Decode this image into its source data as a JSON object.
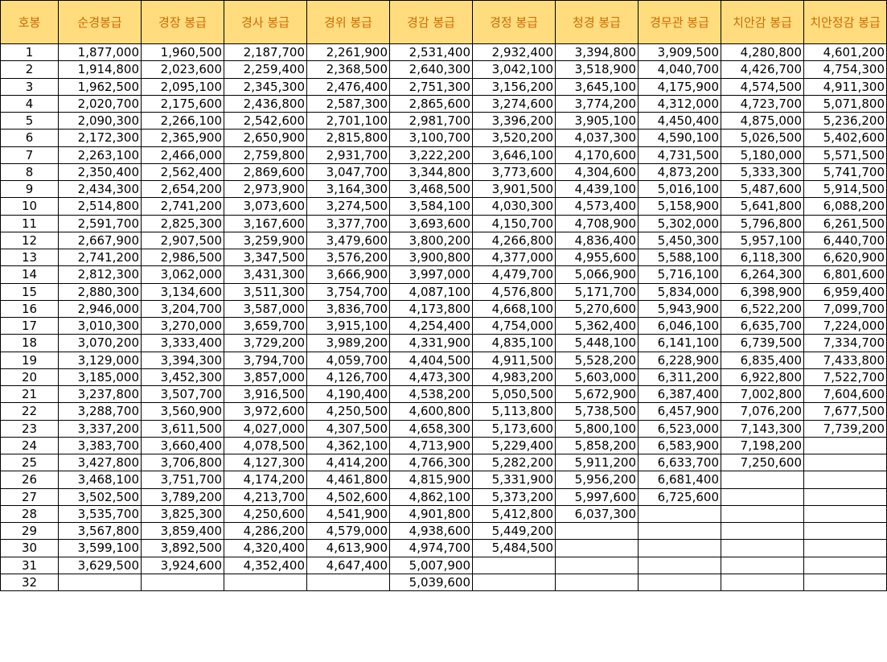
{
  "headers": [
    "호봉",
    "순경봉급",
    "경장 봉급",
    "경사 봉급",
    "경위 봉급",
    "경감 봉급",
    "경정 봉급",
    "청경 봉급",
    "경무관 봉급",
    "치안감 봉급",
    "치안정감 봉급"
  ],
  "rows": [
    {
      "step": "1",
      "pay": [
        "1,877,000",
        "1,960,500",
        "2,187,700",
        "2,261,900",
        "2,531,400",
        "2,932,400",
        "3,394,800",
        "3,909,500",
        "4,280,800",
        "4,601,200"
      ]
    },
    {
      "step": "2",
      "pay": [
        "1,914,800",
        "2,023,600",
        "2,259,400",
        "2,368,500",
        "2,640,300",
        "3,042,100",
        "3,518,900",
        "4,040,700",
        "4,426,700",
        "4,754,300"
      ]
    },
    {
      "step": "3",
      "pay": [
        "1,962,500",
        "2,095,100",
        "2,345,300",
        "2,476,400",
        "2,751,300",
        "3,156,200",
        "3,645,100",
        "4,175,900",
        "4,574,500",
        "4,911,300"
      ]
    },
    {
      "step": "4",
      "pay": [
        "2,020,700",
        "2,175,600",
        "2,436,800",
        "2,587,300",
        "2,865,600",
        "3,274,600",
        "3,774,200",
        "4,312,000",
        "4,723,700",
        "5,071,800"
      ]
    },
    {
      "step": "5",
      "pay": [
        "2,090,300",
        "2,266,100",
        "2,542,600",
        "2,701,100",
        "2,981,700",
        "3,396,200",
        "3,905,100",
        "4,450,400",
        "4,875,000",
        "5,236,200"
      ]
    },
    {
      "step": "6",
      "pay": [
        "2,172,300",
        "2,365,900",
        "2,650,900",
        "2,815,800",
        "3,100,700",
        "3,520,200",
        "4,037,300",
        "4,590,100",
        "5,026,500",
        "5,402,600"
      ]
    },
    {
      "step": "7",
      "pay": [
        "2,263,100",
        "2,466,000",
        "2,759,800",
        "2,931,700",
        "3,222,200",
        "3,646,100",
        "4,170,600",
        "4,731,500",
        "5,180,000",
        "5,571,500"
      ]
    },
    {
      "step": "8",
      "pay": [
        "2,350,400",
        "2,562,400",
        "2,869,600",
        "3,047,700",
        "3,344,800",
        "3,773,600",
        "4,304,600",
        "4,873,200",
        "5,333,300",
        "5,741,700"
      ]
    },
    {
      "step": "9",
      "pay": [
        "2,434,300",
        "2,654,200",
        "2,973,900",
        "3,164,300",
        "3,468,500",
        "3,901,500",
        "4,439,100",
        "5,016,100",
        "5,487,600",
        "5,914,500"
      ]
    },
    {
      "step": "10",
      "pay": [
        "2,514,800",
        "2,741,200",
        "3,073,600",
        "3,274,500",
        "3,584,100",
        "4,030,300",
        "4,573,400",
        "5,158,900",
        "5,641,800",
        "6,088,200"
      ]
    },
    {
      "step": "11",
      "pay": [
        "2,591,700",
        "2,825,300",
        "3,167,600",
        "3,377,700",
        "3,693,600",
        "4,150,700",
        "4,708,900",
        "5,302,000",
        "5,796,800",
        "6,261,500"
      ]
    },
    {
      "step": "12",
      "pay": [
        "2,667,900",
        "2,907,500",
        "3,259,900",
        "3,479,600",
        "3,800,200",
        "4,266,800",
        "4,836,400",
        "5,450,300",
        "5,957,100",
        "6,440,700"
      ]
    },
    {
      "step": "13",
      "pay": [
        "2,741,200",
        "2,986,500",
        "3,347,500",
        "3,576,200",
        "3,900,800",
        "4,377,000",
        "4,955,600",
        "5,588,100",
        "6,118,300",
        "6,620,900"
      ]
    },
    {
      "step": "14",
      "pay": [
        "2,812,300",
        "3,062,000",
        "3,431,300",
        "3,666,900",
        "3,997,000",
        "4,479,700",
        "5,066,900",
        "5,716,100",
        "6,264,300",
        "6,801,600"
      ]
    },
    {
      "step": "15",
      "pay": [
        "2,880,300",
        "3,134,600",
        "3,511,300",
        "3,754,700",
        "4,087,100",
        "4,576,800",
        "5,171,700",
        "5,834,000",
        "6,398,900",
        "6,959,400"
      ]
    },
    {
      "step": "16",
      "pay": [
        "2,946,000",
        "3,204,700",
        "3,587,000",
        "3,836,700",
        "4,173,800",
        "4,668,100",
        "5,270,600",
        "5,943,900",
        "6,522,200",
        "7,099,700"
      ]
    },
    {
      "step": "17",
      "pay": [
        "3,010,300",
        "3,270,000",
        "3,659,700",
        "3,915,100",
        "4,254,400",
        "4,754,000",
        "5,362,400",
        "6,046,100",
        "6,635,700",
        "7,224,000"
      ]
    },
    {
      "step": "18",
      "pay": [
        "3,070,200",
        "3,333,400",
        "3,729,200",
        "3,989,200",
        "4,331,900",
        "4,835,100",
        "5,448,100",
        "6,141,100",
        "6,739,500",
        "7,334,700"
      ]
    },
    {
      "step": "19",
      "pay": [
        "3,129,000",
        "3,394,300",
        "3,794,700",
        "4,059,700",
        "4,404,500",
        "4,911,500",
        "5,528,200",
        "6,228,900",
        "6,835,400",
        "7,433,800"
      ]
    },
    {
      "step": "20",
      "pay": [
        "3,185,000",
        "3,452,300",
        "3,857,000",
        "4,126,700",
        "4,473,300",
        "4,983,200",
        "5,603,000",
        "6,311,200",
        "6,922,800",
        "7,522,700"
      ]
    },
    {
      "step": "21",
      "pay": [
        "3,237,800",
        "3,507,700",
        "3,916,500",
        "4,190,400",
        "4,538,200",
        "5,050,500",
        "5,672,900",
        "6,387,400",
        "7,002,800",
        "7,604,600"
      ]
    },
    {
      "step": "22",
      "pay": [
        "3,288,700",
        "3,560,900",
        "3,972,600",
        "4,250,500",
        "4,600,800",
        "5,113,800",
        "5,738,500",
        "6,457,900",
        "7,076,200",
        "7,677,500"
      ]
    },
    {
      "step": "23",
      "pay": [
        "3,337,200",
        "3,611,500",
        "4,027,000",
        "4,307,500",
        "4,658,300",
        "5,173,600",
        "5,800,100",
        "6,523,000",
        "7,143,300",
        "7,739,200"
      ]
    },
    {
      "step": "24",
      "pay": [
        "3,383,700",
        "3,660,400",
        "4,078,500",
        "4,362,100",
        "4,713,900",
        "5,229,400",
        "5,858,200",
        "6,583,900",
        "7,198,200",
        ""
      ]
    },
    {
      "step": "25",
      "pay": [
        "3,427,800",
        "3,706,800",
        "4,127,300",
        "4,414,200",
        "4,766,300",
        "5,282,200",
        "5,911,200",
        "6,633,700",
        "7,250,600",
        ""
      ]
    },
    {
      "step": "26",
      "pay": [
        "3,468,100",
        "3,751,700",
        "4,174,200",
        "4,461,800",
        "4,815,900",
        "5,331,900",
        "5,956,200",
        "6,681,400",
        "",
        ""
      ]
    },
    {
      "step": "27",
      "pay": [
        "3,502,500",
        "3,789,200",
        "4,213,700",
        "4,502,600",
        "4,862,100",
        "5,373,200",
        "5,997,600",
        "6,725,600",
        "",
        ""
      ]
    },
    {
      "step": "28",
      "pay": [
        "3,535,700",
        "3,825,300",
        "4,250,600",
        "4,541,900",
        "4,901,800",
        "5,412,800",
        "6,037,300",
        "",
        "",
        ""
      ]
    },
    {
      "step": "29",
      "pay": [
        "3,567,800",
        "3,859,400",
        "4,286,200",
        "4,579,000",
        "4,938,600",
        "5,449,200",
        "",
        "",
        "",
        ""
      ]
    },
    {
      "step": "30",
      "pay": [
        "3,599,100",
        "3,892,500",
        "4,320,400",
        "4,613,900",
        "4,974,700",
        "5,484,500",
        "",
        "",
        "",
        ""
      ]
    },
    {
      "step": "31",
      "pay": [
        "3,629,500",
        "3,924,600",
        "4,352,400",
        "4,647,400",
        "5,007,900",
        "",
        "",
        "",
        "",
        ""
      ]
    },
    {
      "step": "32",
      "pay": [
        "",
        "",
        "",
        "",
        "5,039,600",
        "",
        "",
        "",
        "",
        ""
      ]
    }
  ]
}
